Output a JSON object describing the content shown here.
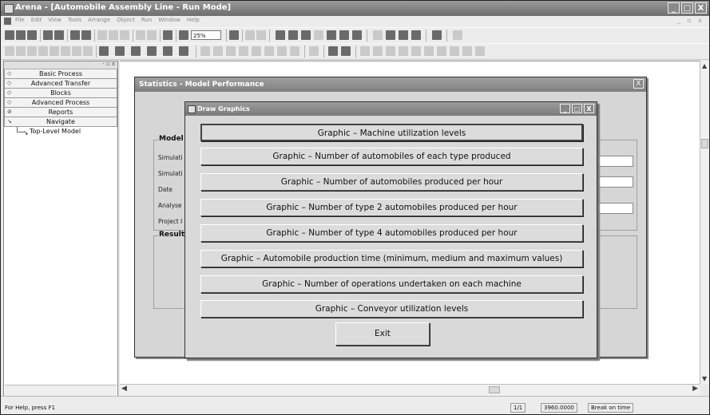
{
  "window": {
    "title": "Arena - [Automobile Assembly Line - Run Mode]",
    "controls": [
      "_",
      "□",
      "X"
    ]
  },
  "menu": {
    "items": [
      "File",
      "Edit",
      "View",
      "Tools",
      "Arrange",
      "Object",
      "Run",
      "Window",
      "Help"
    ]
  },
  "toolbar": {
    "zoom_value": "25%"
  },
  "project_bar": {
    "panels": [
      {
        "label": "Basic Process",
        "icon": "diamond-icon"
      },
      {
        "label": "Advanced Transfer",
        "icon": "diamond-icon"
      },
      {
        "label": "Blocks",
        "icon": "diamond-icon"
      },
      {
        "label": "Advanced Process",
        "icon": "diamond-icon"
      },
      {
        "label": "Reports",
        "icon": "report-icon"
      },
      {
        "label": "Navigate",
        "icon": "navigate-icon"
      }
    ],
    "tree_item": "Top-Level Model"
  },
  "stats_window": {
    "title": "Statistics - Model Performance",
    "close": "X",
    "model_group": {
      "title": "Model",
      "fields": [
        "Simulati",
        "Simulati",
        "Date",
        "Analyse",
        "Project I"
      ]
    },
    "results_group": {
      "title": "Results"
    }
  },
  "draw_window": {
    "title": "Draw Graphics",
    "controls": [
      "_",
      "□",
      "X"
    ],
    "buttons": [
      "Graphic – Machine utilization levels",
      "Graphic – Number of automobiles of each type produced",
      "Graphic – Number of automobiles produced per hour",
      "Graphic – Number of type 2 automobiles produced per hour",
      "Graphic – Number of type 4 automobiles produced per hour",
      "Graphic – Automobile production time (minimum, medium and maximum values)",
      "Graphic – Number of operations undertaken on each machine",
      "Graphic – Conveyor utilization levels"
    ],
    "exit_label": "Exit"
  },
  "status": {
    "help_text": "For Help, press F1",
    "replication": "1/1",
    "time": "3960.0000",
    "state": "Break on time"
  }
}
